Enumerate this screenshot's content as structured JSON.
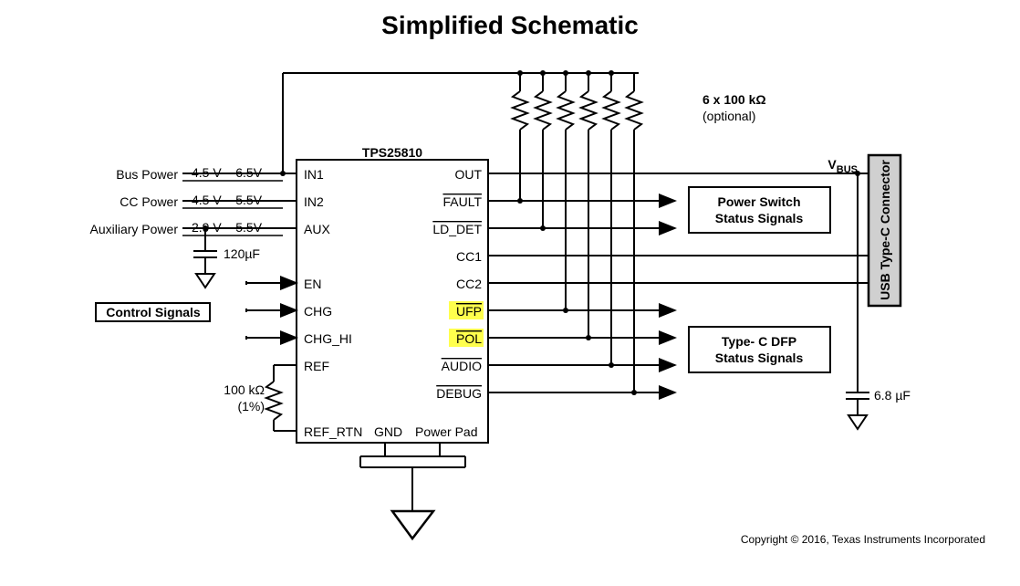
{
  "title": "Simplified Schematic",
  "chip": {
    "name": "TPS25810",
    "left_pins": [
      "IN1",
      "IN2",
      "AUX",
      "EN",
      "CHG",
      "CHG_HI",
      "REF",
      "REF_RTN"
    ],
    "right_pins": [
      "OUT",
      "FAULT",
      "LD_DET",
      "CC1",
      "CC2",
      "UFP",
      "POL",
      "AUDIO",
      "DEBUG"
    ],
    "bottom_pins": [
      "GND",
      "Power Pad"
    ]
  },
  "inputs": {
    "bus_power": {
      "label": "Bus Power",
      "range": "4.5 V – 6.5V"
    },
    "cc_power": {
      "label": "CC Power",
      "range": "4.5 V – 5.5V"
    },
    "aux_power": {
      "label": "Auxiliary Power",
      "range": "2.9 V – 5.5V"
    },
    "control_signals": "Control Signals"
  },
  "components": {
    "input_cap": "120µF",
    "ref_resistor": {
      "value": "100 kΩ",
      "tolerance": "(1%)"
    },
    "pullups": {
      "label": "6 x  100 kΩ",
      "optional": "(optional)"
    },
    "output_cap": "6.8 µF"
  },
  "outputs": {
    "vbus": "VBUS",
    "connector": "USB Type-C Connector",
    "power_switch": "Power Switch Status Signals",
    "dfp_status": "Type- C DFP Status Signals"
  },
  "copyright": "Copyright © 2016, Texas Instruments Incorporated"
}
